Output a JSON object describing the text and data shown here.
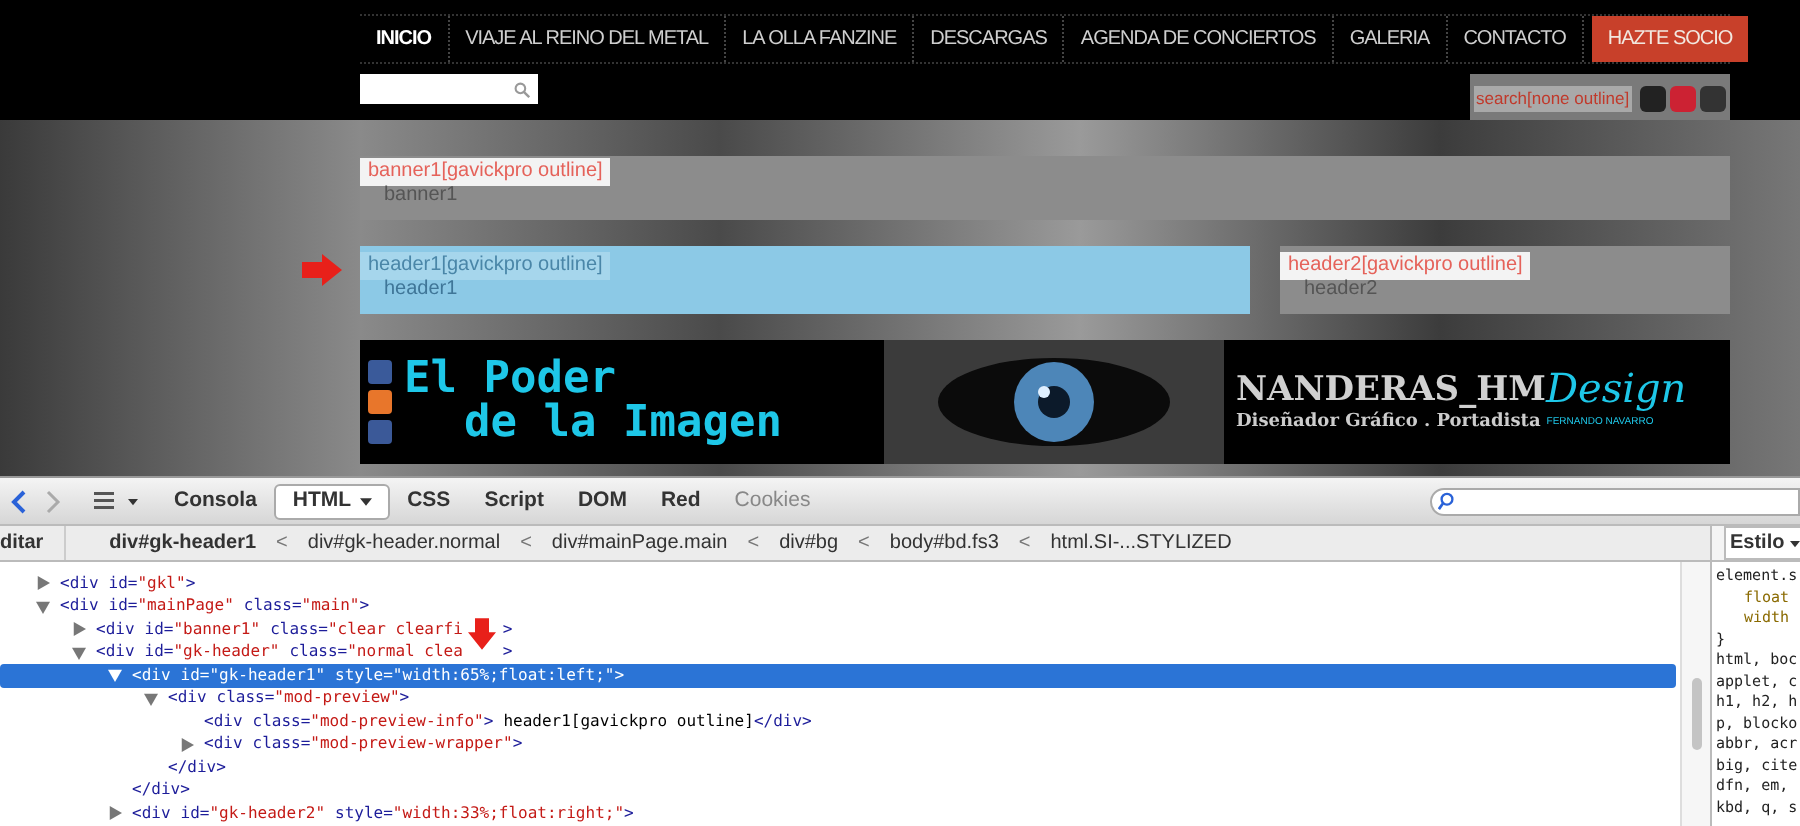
{
  "nav": [
    {
      "label": "INICIO",
      "selected": true,
      "kind": "link"
    },
    {
      "label": "VIAJE AL REINO DEL METAL",
      "selected": false,
      "kind": "link"
    },
    {
      "label": "LA OLLA FANZINE",
      "selected": false,
      "kind": "link"
    },
    {
      "label": "DESCARGAS",
      "selected": false,
      "kind": "link"
    },
    {
      "label": "AGENDA DE CONCIERTOS",
      "selected": false,
      "kind": "link"
    },
    {
      "label": "GALERIA",
      "selected": false,
      "kind": "link"
    },
    {
      "label": "CONTACTO",
      "selected": false,
      "kind": "link"
    },
    {
      "label": "HAZTE SOCIO",
      "selected": false,
      "kind": "highlight"
    }
  ],
  "social_overlay": {
    "label": "search[none outline]"
  },
  "banner1": {
    "label": "banner1[gavickpro outline]",
    "name": "banner1"
  },
  "header1": {
    "label": "header1[gavickpro outline]",
    "name": "header1",
    "highlighted": true
  },
  "header2": {
    "label": "header2[gavickpro outline]",
    "name": "header2",
    "highlighted": false
  },
  "banner_ad": {
    "title_lines": [
      "El Poder",
      "de la Imagen"
    ],
    "brand": "NANDERAS_HM",
    "brand_script": "Design",
    "tagline": "Diseñador Gráfico . Portadista",
    "author": "FERNANDO NAVARRO"
  },
  "devtools": {
    "tabs": [
      {
        "label": "Consola",
        "selected": false,
        "disabled": false
      },
      {
        "label": "HTML",
        "selected": true,
        "disabled": false
      },
      {
        "label": "CSS",
        "selected": false,
        "disabled": false
      },
      {
        "label": "Script",
        "selected": false,
        "disabled": false
      },
      {
        "label": "DOM",
        "selected": false,
        "disabled": false
      },
      {
        "label": "Red",
        "selected": false,
        "disabled": false
      },
      {
        "label": "Cookies",
        "selected": false,
        "disabled": true
      }
    ],
    "breadcrumb": {
      "lead": "ditar",
      "items": [
        {
          "label": "div#gk-header1",
          "selected": true
        },
        {
          "label": "div#gk-header.normal",
          "selected": false
        },
        {
          "label": "div#mainPage.main",
          "selected": false
        },
        {
          "label": "div#bg",
          "selected": false
        },
        {
          "label": "body#bd.fs3",
          "selected": false
        },
        {
          "label": "html.SI-...STYLIZED",
          "selected": false
        }
      ],
      "separators": [
        "<",
        "<",
        "<",
        "<",
        "<"
      ]
    },
    "tree": [
      {
        "tokens": [
          {
            "kind": "tag",
            "text": "<div"
          },
          {
            "kind": "attr",
            "text": "id="
          },
          {
            "kind": "value",
            "text": "\"gkl\""
          },
          {
            "kind": "tag",
            "text": ">"
          }
        ],
        "expanded": false,
        "selected": false
      },
      {
        "tokens": [
          {
            "kind": "tag",
            "text": "<div"
          },
          {
            "kind": "attr",
            "text": "id="
          },
          {
            "kind": "value",
            "text": "\"mainPage\""
          },
          {
            "kind": "attr",
            "text": "class="
          },
          {
            "kind": "value",
            "text": "\"main\""
          },
          {
            "kind": "tag",
            "text": ">"
          }
        ],
        "expanded": true,
        "selected": false,
        "children": [
          {
            "tokens": [
              {
                "kind": "tag",
                "text": "<div"
              },
              {
                "kind": "attr",
                "text": "id="
              },
              {
                "kind": "value",
                "text": "\"banner1\""
              },
              {
                "kind": "attr",
                "text": "class="
              },
              {
                "kind": "value_cut",
                "text": "\"clear clearfi"
              },
              {
                "kind": "tag",
                "text": ">"
              }
            ],
            "expanded": false,
            "selected": false
          },
          {
            "tokens": [
              {
                "kind": "tag",
                "text": "<div"
              },
              {
                "kind": "attr",
                "text": "id="
              },
              {
                "kind": "value",
                "text": "\"gk-header\""
              },
              {
                "kind": "attr",
                "text": "class="
              },
              {
                "kind": "value_cut",
                "text": "\"normal clea"
              },
              {
                "kind": "tag",
                "text": ">"
              }
            ],
            "expanded": true,
            "selected": false,
            "children": [
              {
                "tokens": [
                  {
                    "kind": "tag",
                    "text": "<div"
                  },
                  {
                    "kind": "attr",
                    "text": "id="
                  },
                  {
                    "kind": "value",
                    "text": "\"gk-header1\""
                  },
                  {
                    "kind": "attr",
                    "text": "style="
                  },
                  {
                    "kind": "value",
                    "text": "\"width:65%;float:left;\""
                  },
                  {
                    "kind": "tag",
                    "text": ">"
                  }
                ],
                "expanded": true,
                "selected": true,
                "closing": "</div>",
                "children": [
                  {
                    "tokens": [
                      {
                        "kind": "tag",
                        "text": "<div"
                      },
                      {
                        "kind": "attr",
                        "text": "class="
                      },
                      {
                        "kind": "value",
                        "text": "\"mod-preview\""
                      },
                      {
                        "kind": "tag",
                        "text": ">"
                      }
                    ],
                    "expanded": true,
                    "selected": false,
                    "closing": "</div>",
                    "children": [
                      {
                        "tokens": [
                          {
                            "kind": "tag",
                            "text": "<div"
                          },
                          {
                            "kind": "attr",
                            "text": "class="
                          },
                          {
                            "kind": "value",
                            "text": "\"mod-preview-info\""
                          },
                          {
                            "kind": "tag",
                            "text": ">"
                          },
                          {
                            "kind": "text",
                            "text": "header1[gavickpro outline]"
                          },
                          {
                            "kind": "tag",
                            "text": "</div>"
                          }
                        ],
                        "selected": false
                      },
                      {
                        "tokens": [
                          {
                            "kind": "tag",
                            "text": "<div"
                          },
                          {
                            "kind": "attr",
                            "text": "class="
                          },
                          {
                            "kind": "value",
                            "text": "\"mod-preview-wrapper\""
                          },
                          {
                            "kind": "tag",
                            "text": ">"
                          }
                        ],
                        "expanded": false,
                        "selected": false
                      }
                    ]
                  }
                ]
              },
              {
                "tokens": [
                  {
                    "kind": "tag",
                    "text": "<div"
                  },
                  {
                    "kind": "attr",
                    "text": "id="
                  },
                  {
                    "kind": "value",
                    "text": "\"gk-header2\""
                  },
                  {
                    "kind": "attr",
                    "text": "style="
                  },
                  {
                    "kind": "value",
                    "text": "\"width:33%;float:right;\""
                  },
                  {
                    "kind": "tag",
                    "text": ">"
                  }
                ],
                "expanded": false,
                "selected": false
              }
            ]
          }
        ]
      }
    ],
    "style_panel": {
      "menu": "Estilo",
      "lines": [
        {
          "kind": "selector",
          "text": "element.s"
        },
        {
          "kind": "property",
          "text": "float"
        },
        {
          "kind": "property",
          "text": "width"
        },
        {
          "kind": "brace",
          "text": "}"
        },
        {
          "kind": "selector",
          "text": "html, boc"
        },
        {
          "kind": "selector",
          "text": "applet, c"
        },
        {
          "kind": "selector",
          "text": "h1, h2, h"
        },
        {
          "kind": "selector",
          "text": "p, blocko"
        },
        {
          "kind": "selector",
          "text": "abbr, acr"
        },
        {
          "kind": "selector",
          "text": "big, cite"
        },
        {
          "kind": "selector",
          "text": "dfn, em,"
        },
        {
          "kind": "selector",
          "text": "kbd, q, s"
        }
      ]
    }
  }
}
